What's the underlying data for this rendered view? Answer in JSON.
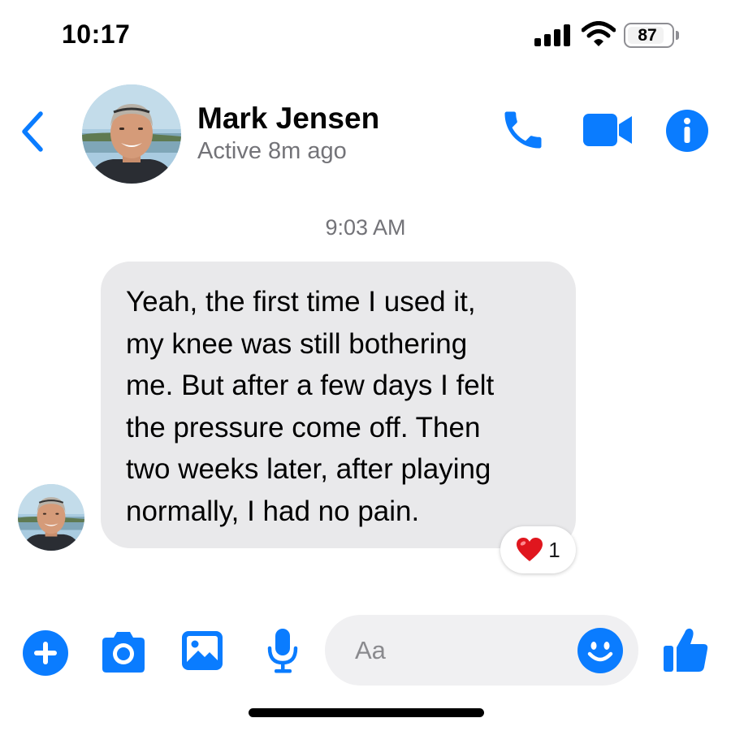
{
  "status_bar": {
    "time": "10:17",
    "battery_percent": "87"
  },
  "header": {
    "contact_name": "Mark Jensen",
    "contact_status": "Active 8m ago",
    "icons": {
      "back": "chevron-left-icon",
      "call": "phone-icon",
      "video": "video-camera-icon",
      "info": "info-icon"
    }
  },
  "conversation": {
    "timestamp": "9:03 AM",
    "messages": [
      {
        "sender": "Mark Jensen",
        "lines": [
          "Yeah, the first time I used it,",
          "my knee was still bothering",
          "me. But after a few days I felt",
          "the pressure come off. Then",
          "two weeks later, after playing",
          "normally, I had no pain."
        ],
        "reaction": {
          "emoji": "❤️",
          "count": "1"
        }
      }
    ]
  },
  "composer": {
    "placeholder": "Aa",
    "icons": [
      "plus-icon",
      "camera-icon",
      "image-icon",
      "microphone-icon",
      "emoji-icon",
      "thumbs-up-icon"
    ]
  },
  "colors": {
    "accent": "#0a7cff",
    "bubble_incoming": "#e9e9eb",
    "secondary_text": "#737378",
    "input_background": "#f0f0f2"
  }
}
